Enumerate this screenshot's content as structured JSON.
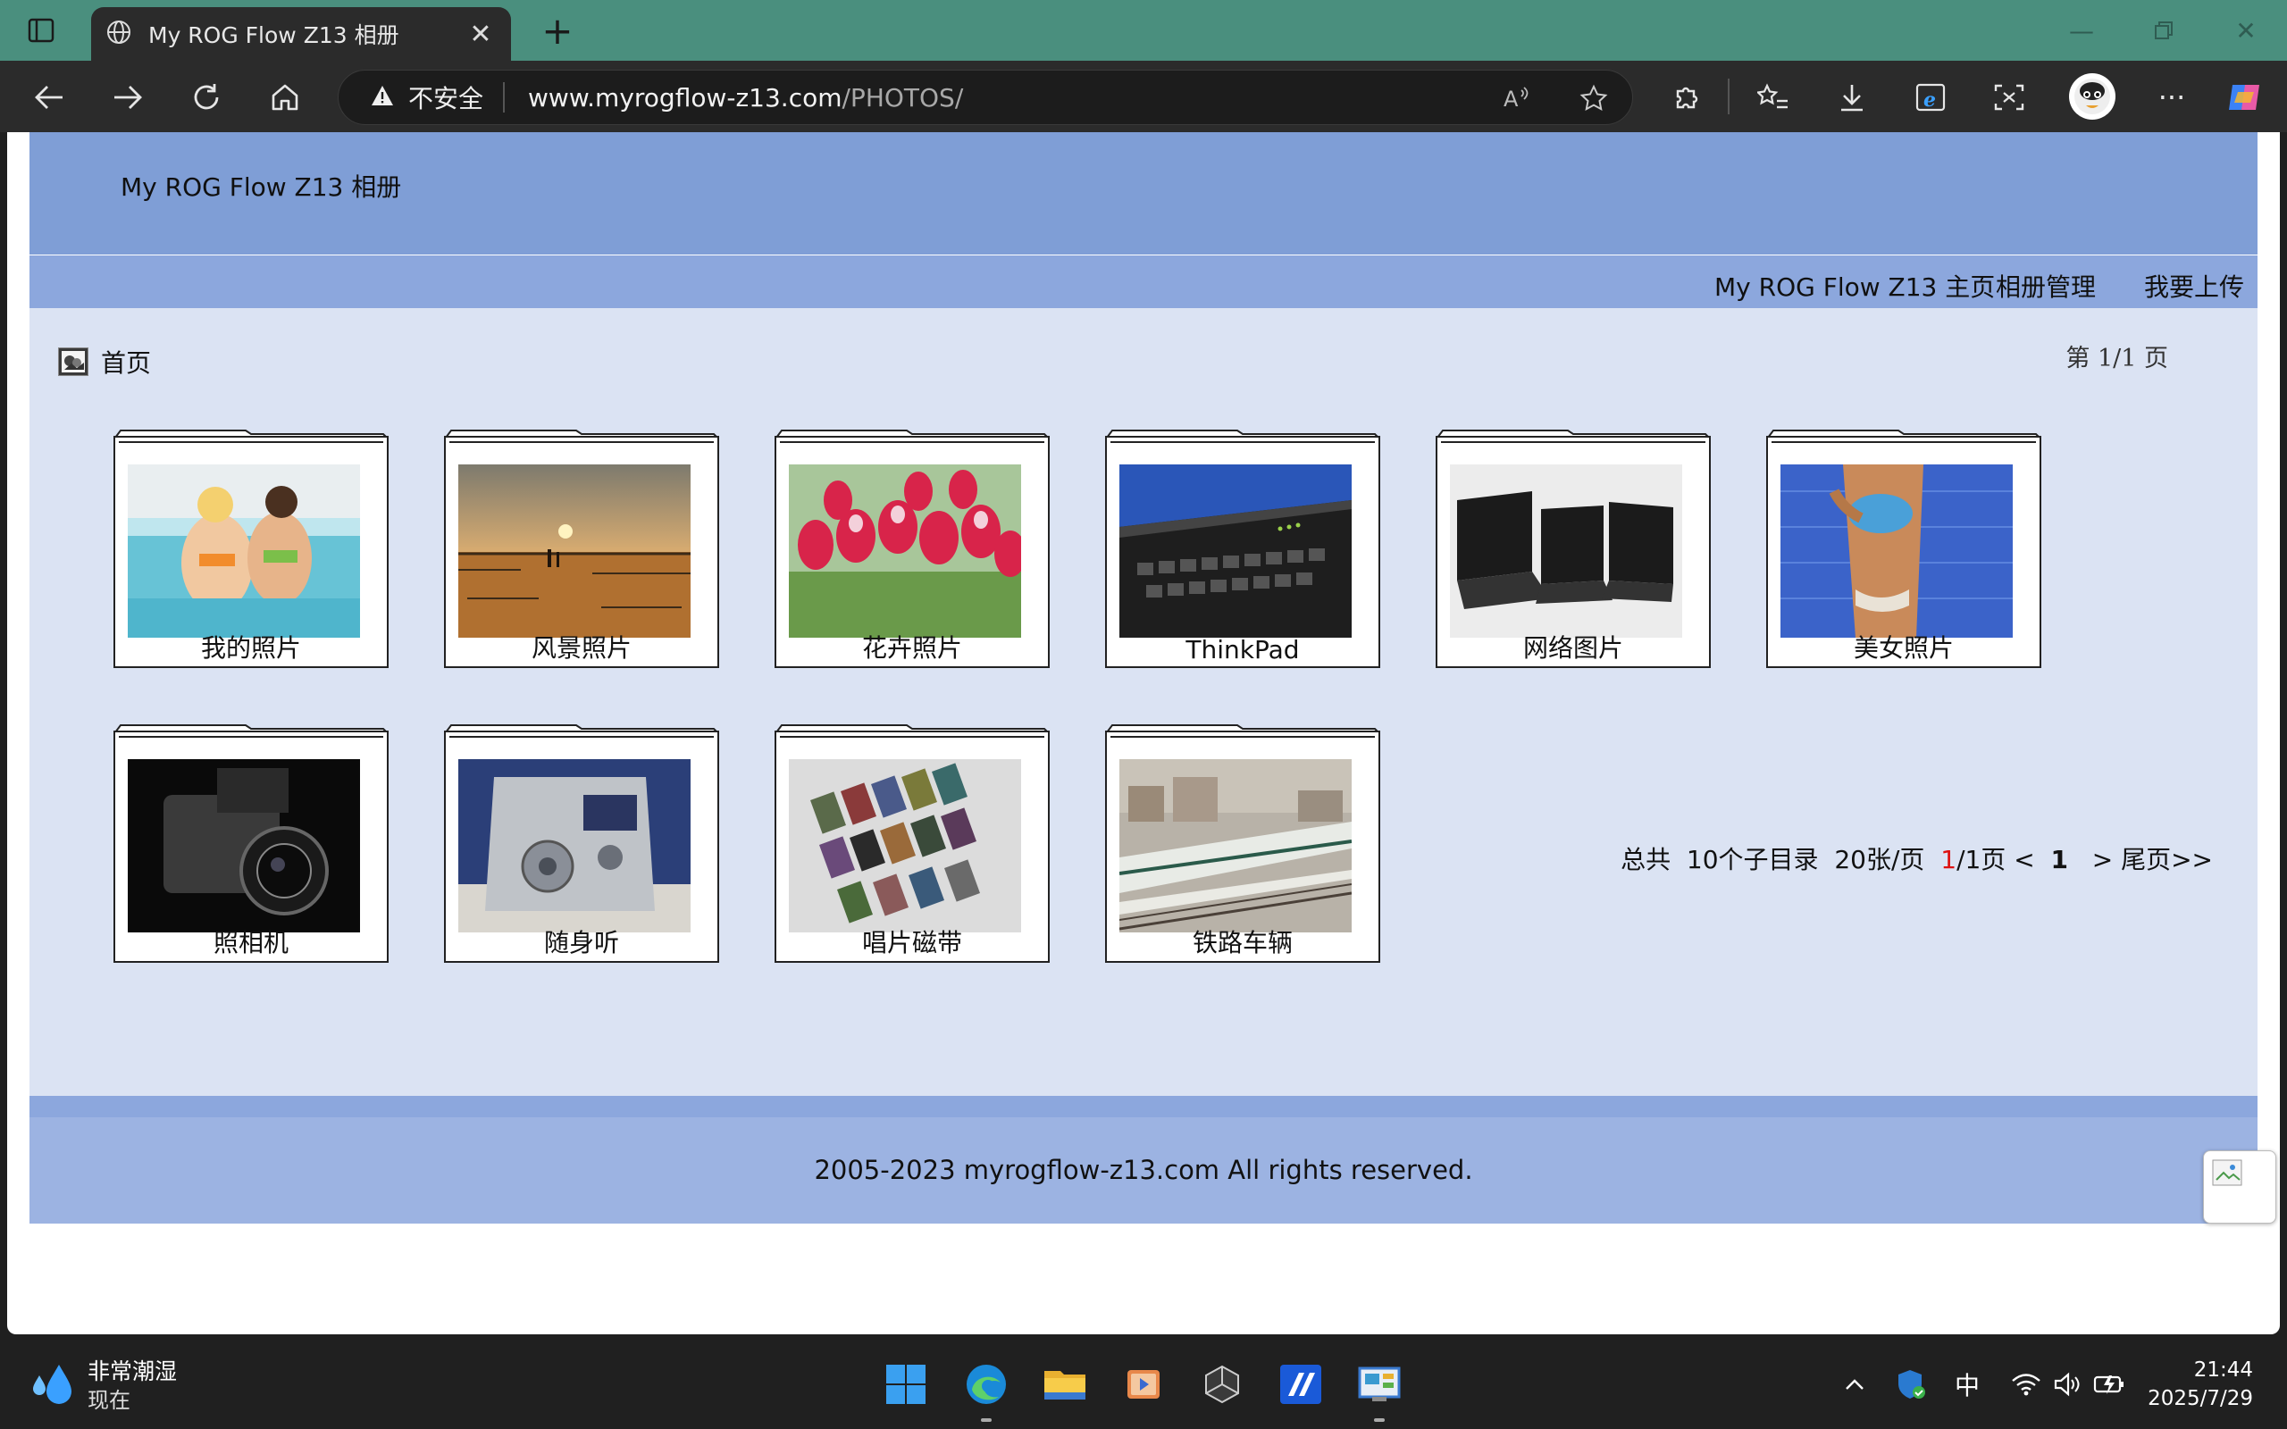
{
  "browser": {
    "tab_title": "My ROG Flow Z13 相册",
    "tab_close": "✕",
    "new_tab": "+",
    "insecure_label": "不安全",
    "url_host": "www.myrogflow-z13.com",
    "url_path": "/PHOTOS/"
  },
  "site": {
    "title": "My ROG Flow Z13 相册",
    "nav": [
      "My ROG Flow Z13 主页",
      "相册管理",
      "我要上传"
    ],
    "breadcrumb": "首页",
    "page_indicator": "第 1/1 页",
    "albums": [
      {
        "label": "我的照片",
        "thumb": "pool-icon"
      },
      {
        "label": "风景照片",
        "thumb": "sunset-icon"
      },
      {
        "label": "花卉照片",
        "thumb": "tulips-icon"
      },
      {
        "label": "ThinkPad",
        "thumb": "laptop-keyboard-icon"
      },
      {
        "label": "网络图片",
        "thumb": "laptops-icon"
      },
      {
        "label": "美女照片",
        "thumb": "beach-icon"
      },
      {
        "label": "照相机",
        "thumb": "camera-icon"
      },
      {
        "label": "随身听",
        "thumb": "minidisc-icon"
      },
      {
        "label": "唱片磁带",
        "thumb": "cassettes-icon"
      },
      {
        "label": "铁路车辆",
        "thumb": "train-icon"
      }
    ],
    "pager": {
      "total": "总共",
      "subdirs": "10个子目录",
      "per_page": "20张/页",
      "current": "1",
      "of_pages": "/1页",
      "prev": "<",
      "page": "1",
      "next": ">",
      "last": "尾页>>"
    },
    "footer": "2005-2023 myrogflow-z13.com All rights reserved."
  },
  "taskbar": {
    "weather_line1": "非常潮湿",
    "weather_line2": "现在",
    "ime": "中",
    "time": "21:44",
    "date": "2025/7/29"
  },
  "colors": {
    "titlebar": "#4a8f7e",
    "header": "#7f9ed6",
    "nav": "#8ca7dd",
    "content": "#dbe3f3",
    "footer": "#9cb3e2",
    "pager_current": "#dd1111"
  }
}
